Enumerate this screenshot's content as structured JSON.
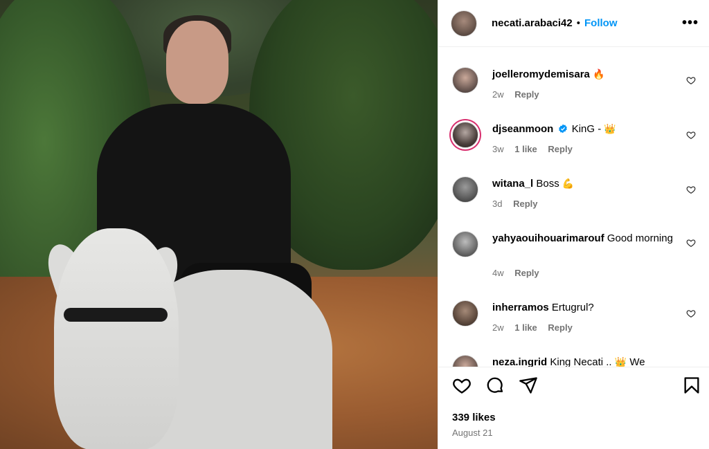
{
  "post": {
    "author": "necati.arabaci42",
    "separator": "•",
    "follow_label": "Follow",
    "more_label": "•••",
    "likes": "339 likes",
    "date": "August 21"
  },
  "comments": [
    {
      "username": "joelleromydemisara",
      "text": "",
      "emoji": "🔥",
      "verified": false,
      "time": "2w",
      "likes": "",
      "reply": "Reply"
    },
    {
      "username": "djseanmoon",
      "text": "KinG -",
      "emoji": "👑",
      "verified": true,
      "time": "3w",
      "likes": "1 like",
      "reply": "Reply"
    },
    {
      "username": "witana_l",
      "text": "Boss",
      "emoji": "💪",
      "verified": false,
      "time": "3d",
      "likes": "",
      "reply": "Reply"
    },
    {
      "username": "yahyaouihouarimarouf",
      "text": "Good morning",
      "emoji": "",
      "verified": false,
      "time": "4w",
      "likes": "",
      "reply": "Reply"
    },
    {
      "username": "inherramos",
      "text": "Ertugrul?",
      "emoji": "",
      "verified": false,
      "time": "2w",
      "likes": "1 like",
      "reply": "Reply"
    },
    {
      "username": "neza.ingrid",
      "text": "King Necati ..",
      "emoji": "👑",
      "verified": false,
      "time": "",
      "likes": "",
      "reply": ""
    }
  ],
  "partial_comment_tail": "We",
  "icons": {
    "more": "more-icon",
    "like": "heart-icon",
    "comment": "comment-icon",
    "share": "share-icon",
    "save": "bookmark-icon",
    "verified": "verified-badge-icon"
  },
  "colors": {
    "link": "#0095f6",
    "muted": "#737373",
    "story_ring": "#d8306f",
    "verified": "#0095f6"
  }
}
